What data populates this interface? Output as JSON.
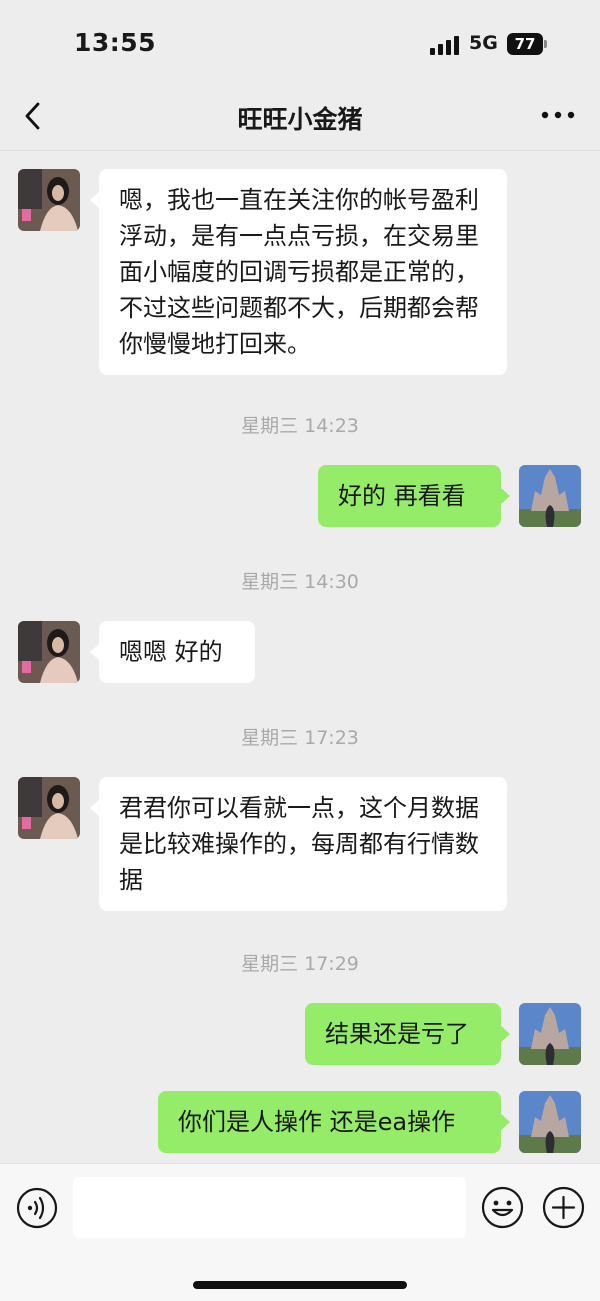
{
  "status_bar": {
    "time": "13:55",
    "network": "5G",
    "battery": "77"
  },
  "header": {
    "title": "旺旺小金猪",
    "back_icon": "chevron-left-icon",
    "more_icon": "ellipsis-icon"
  },
  "messages": [
    {
      "side": "left",
      "avatar": "contact-avatar",
      "text": "嗯，我也一直在关注你的帐号盈利浮动，是有一点点亏损，在交易里面小幅度的回调亏损都是正常的，不过这些问题都不大，后期都会帮你慢慢地打回来。"
    },
    {
      "timestamp": "星期三 14:23"
    },
    {
      "side": "right",
      "avatar": "self-avatar",
      "text": "好的  再看看"
    },
    {
      "timestamp": "星期三 14:30"
    },
    {
      "side": "left",
      "avatar": "contact-avatar",
      "text": "嗯嗯 好的"
    },
    {
      "timestamp": "星期三 17:23"
    },
    {
      "side": "left",
      "avatar": "contact-avatar",
      "text": "君君你可以看就一点，这个月数据是比较难操作的，每周都有行情数据"
    },
    {
      "timestamp": "星期三 17:29"
    },
    {
      "side": "right",
      "avatar": "self-avatar",
      "text": "结果还是亏了"
    },
    {
      "side": "right",
      "avatar": "self-avatar",
      "text": "你们是人操作 还是ea操作"
    }
  ],
  "input_bar": {
    "voice_icon": "voice-icon",
    "emoji_icon": "emoji-icon",
    "plus_icon": "plus-icon",
    "input_value": ""
  },
  "colors": {
    "background": "#ededed",
    "bubble_self": "#95ec69",
    "bubble_other": "#ffffff"
  }
}
